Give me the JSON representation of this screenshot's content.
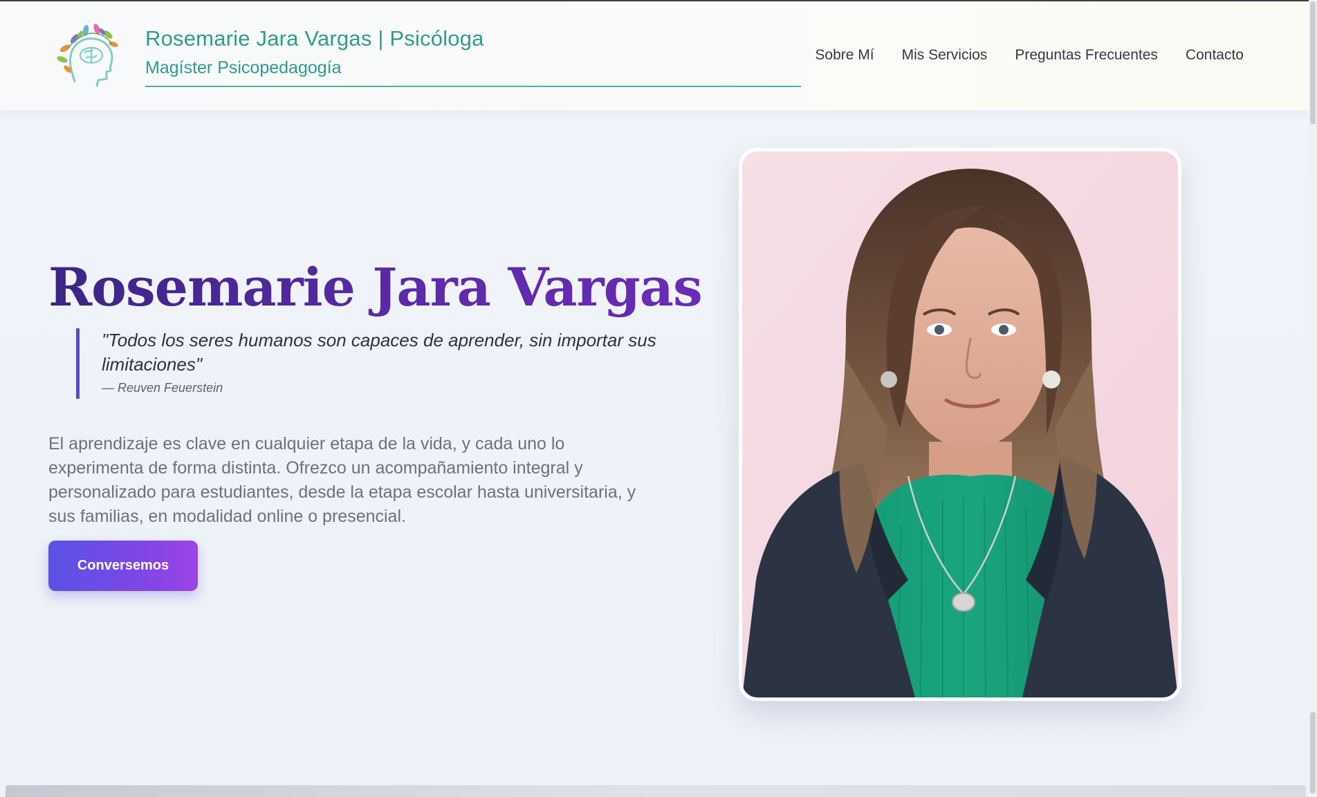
{
  "header": {
    "brand_title": "Rosemarie Jara Vargas | Psicóloga",
    "brand_subtitle": "Magíster Psicopedagogía",
    "logo_icon": "brain-leaves-logo-icon",
    "nav": [
      {
        "label": "Sobre Mí"
      },
      {
        "label": "Mis Servicios"
      },
      {
        "label": "Preguntas Frecuentes"
      },
      {
        "label": "Contacto"
      }
    ]
  },
  "hero": {
    "name": "Rosemarie Jara Vargas",
    "quote": "\"Todos los seres humanos son capaces de aprender, sin importar sus limitaciones\"",
    "quote_author": "— Reuven Feuerstein",
    "paragraph": "El aprendizaje es clave en cualquier etapa de la vida, y cada uno lo experimenta de forma distinta. Ofrezco un acompañamiento integral y personalizado para estudiantes, desde la etapa escolar hasta universitaria, y sus familias, en modalidad online o presencial.",
    "cta_label": "Conversemos",
    "photo_icon": "portrait-photo"
  },
  "colors": {
    "brand_teal": "#2e9c8e",
    "heading_purple": "#3b2585",
    "quote_bar": "#5b49c9",
    "cta_start": "#5a52e6",
    "cta_end": "#9b43e6"
  }
}
